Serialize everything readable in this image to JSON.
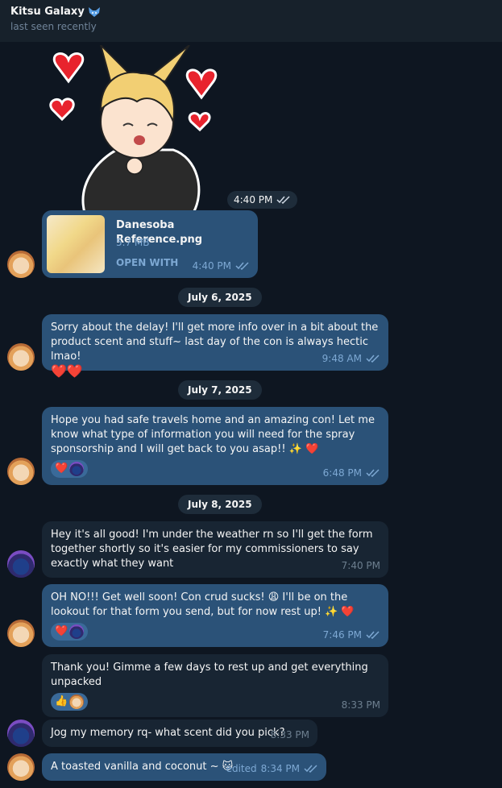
{
  "header": {
    "title": "Kitsu Galaxy",
    "status": "last seen recently"
  },
  "sticker": {
    "time": "4:40 PM"
  },
  "file_message": {
    "name": "Danesoba Reference.png",
    "size": "5.7 MB",
    "action": "OPEN WITH",
    "time": "4:40 PM"
  },
  "dates": [
    "July 6, 2025",
    "July 7, 2025",
    "July 8, 2025"
  ],
  "messages": [
    {
      "text": "Sorry about the delay! I'll get more info over in a bit about the product scent and stuff~ last day of the con is always hectic lmao!",
      "emoji": "❤️❤️",
      "time": "9:48 AM"
    },
    {
      "text": "Hope you had safe travels home and an amazing con! Let me know what type of information you will need for the spray sponsorship and I will get back to you asap!! ✨ ❤️",
      "reaction": "❤️",
      "time": "6:48 PM"
    },
    {
      "text": "Hey it's all good! I'm under the weather rn so I'll get the form together shortly so it's easier for my commissioners to say exactly what they want",
      "time": "7:40 PM"
    },
    {
      "text": "OH NO!!! Get well soon! Con crud sucks! 😩 I'll be on the lookout for that form you send, but for now rest up! ✨ ❤️",
      "reaction": "❤️",
      "time": "7:46 PM"
    },
    {
      "text": "Thank you! Gimme a few days to rest up and get everything unpacked",
      "reaction": "👍",
      "time": "8:33 PM"
    },
    {
      "text": "Jog my memory rq- what scent did you pick?",
      "time": "8:33 PM"
    },
    {
      "text": "A toasted vanilla and coconut ~ 🐱",
      "edited": "edited",
      "time": "8:34 PM"
    }
  ],
  "colors": {
    "background": "#0e1621",
    "outgoing": "#2b5278",
    "incoming": "#182533",
    "header": "#17212b",
    "accent": "#7da8d3"
  }
}
